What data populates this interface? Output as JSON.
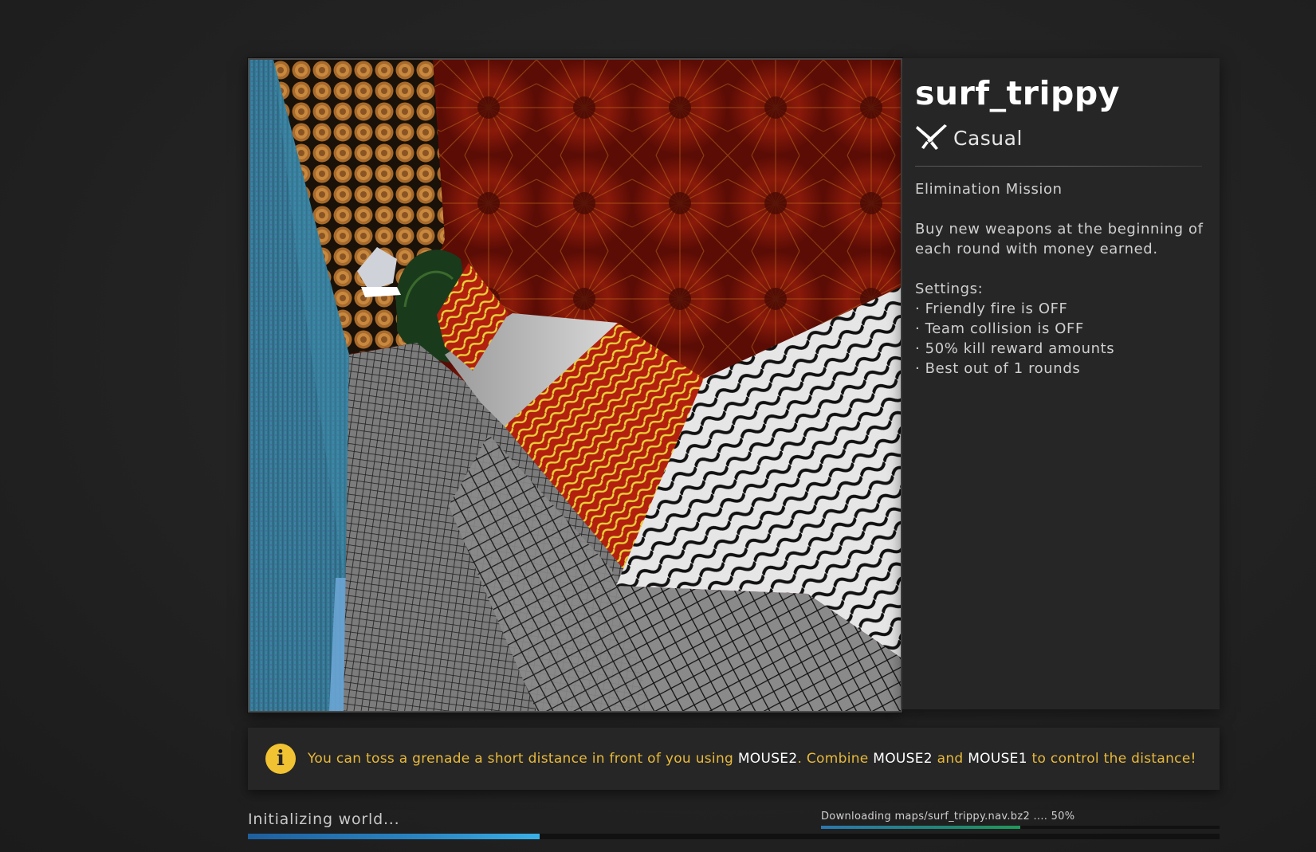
{
  "map": {
    "name": "surf_trippy",
    "mode_icon": "crossed-knives-icon",
    "mode": "Casual",
    "mission": "Elimination Mission",
    "description": "Buy new weapons at the beginning of each round with money earned.",
    "settings_label": "Settings:",
    "settings": [
      "Friendly fire is OFF",
      "Team collision is OFF",
      "50% kill reward amounts",
      "Best out of 1 rounds"
    ]
  },
  "tip": {
    "icon": "info-icon",
    "accent_color": "#e8b93a",
    "text_1": "You can toss a grenade a short distance in front of you using ",
    "key_1": "MOUSE2",
    "text_2": ". Combine ",
    "key_2": "MOUSE2",
    "text_3": " and ",
    "key_3": "MOUSE1",
    "text_4": " to control the distance!"
  },
  "loading": {
    "status": "Initializing world...",
    "progress": 0.3
  },
  "download": {
    "text": "Downloading maps/surf_trippy.nav.bz2 ....  50%",
    "progress": 0.5
  }
}
